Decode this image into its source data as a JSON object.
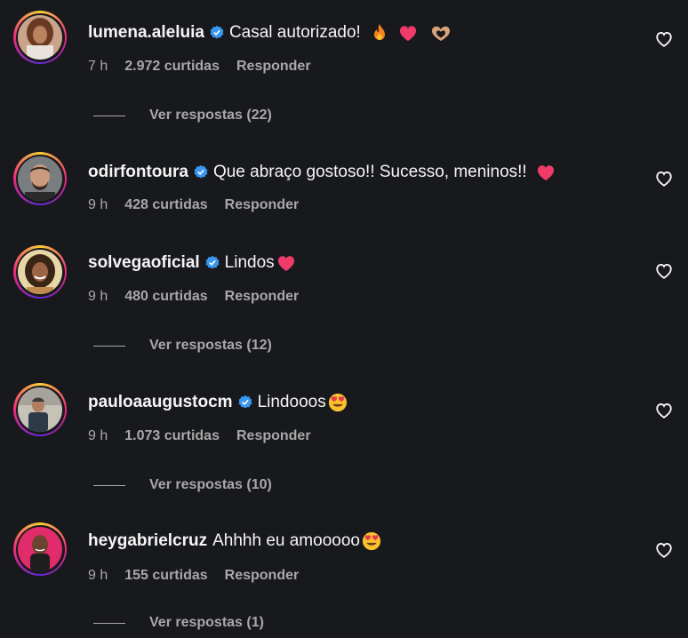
{
  "comments": [
    {
      "username": "lumena.aleluia",
      "text": "Casal autorizado!",
      "emojis": [
        "fire",
        "heart",
        "heart-hands"
      ],
      "time": "7 h",
      "likes": "2.972 curtidas",
      "reply": "Responder",
      "view_replies": "Ver respostas (22)"
    },
    {
      "username": "odirfontoura",
      "text": "Que abraço gostoso!! Sucesso, meninos!!",
      "emojis": [
        "heart"
      ],
      "time": "9 h",
      "likes": "428 curtidas",
      "reply": "Responder",
      "view_replies": ""
    },
    {
      "username": "solvegaoficial",
      "text": "Lindos",
      "emojis": [
        "heart"
      ],
      "time": "9 h",
      "likes": "480 curtidas",
      "reply": "Responder",
      "view_replies": "Ver respostas (12)"
    },
    {
      "username": "pauloaaugustocm",
      "text": "Lindooos",
      "emojis": [
        "heart-eyes"
      ],
      "time": "9 h",
      "likes": "1.073 curtidas",
      "reply": "Responder",
      "view_replies": "Ver respostas (10)"
    },
    {
      "username": "heygabrielcruz",
      "text": "Ahhhh eu amooooo",
      "emojis": [
        "heart-eyes"
      ],
      "time": "9 h",
      "likes": "155 curtidas",
      "reply": "Responder",
      "view_replies": "Ver respostas (1)"
    }
  ],
  "colors": {
    "background": "#18191d",
    "text": "#f5f5f5",
    "muted": "#a8a8a8",
    "verified": "#3897f0",
    "emoji_heart": "#ee3b6a"
  },
  "icons": {
    "verified": "verified-badge-icon",
    "like": "heart-outline-icon"
  }
}
